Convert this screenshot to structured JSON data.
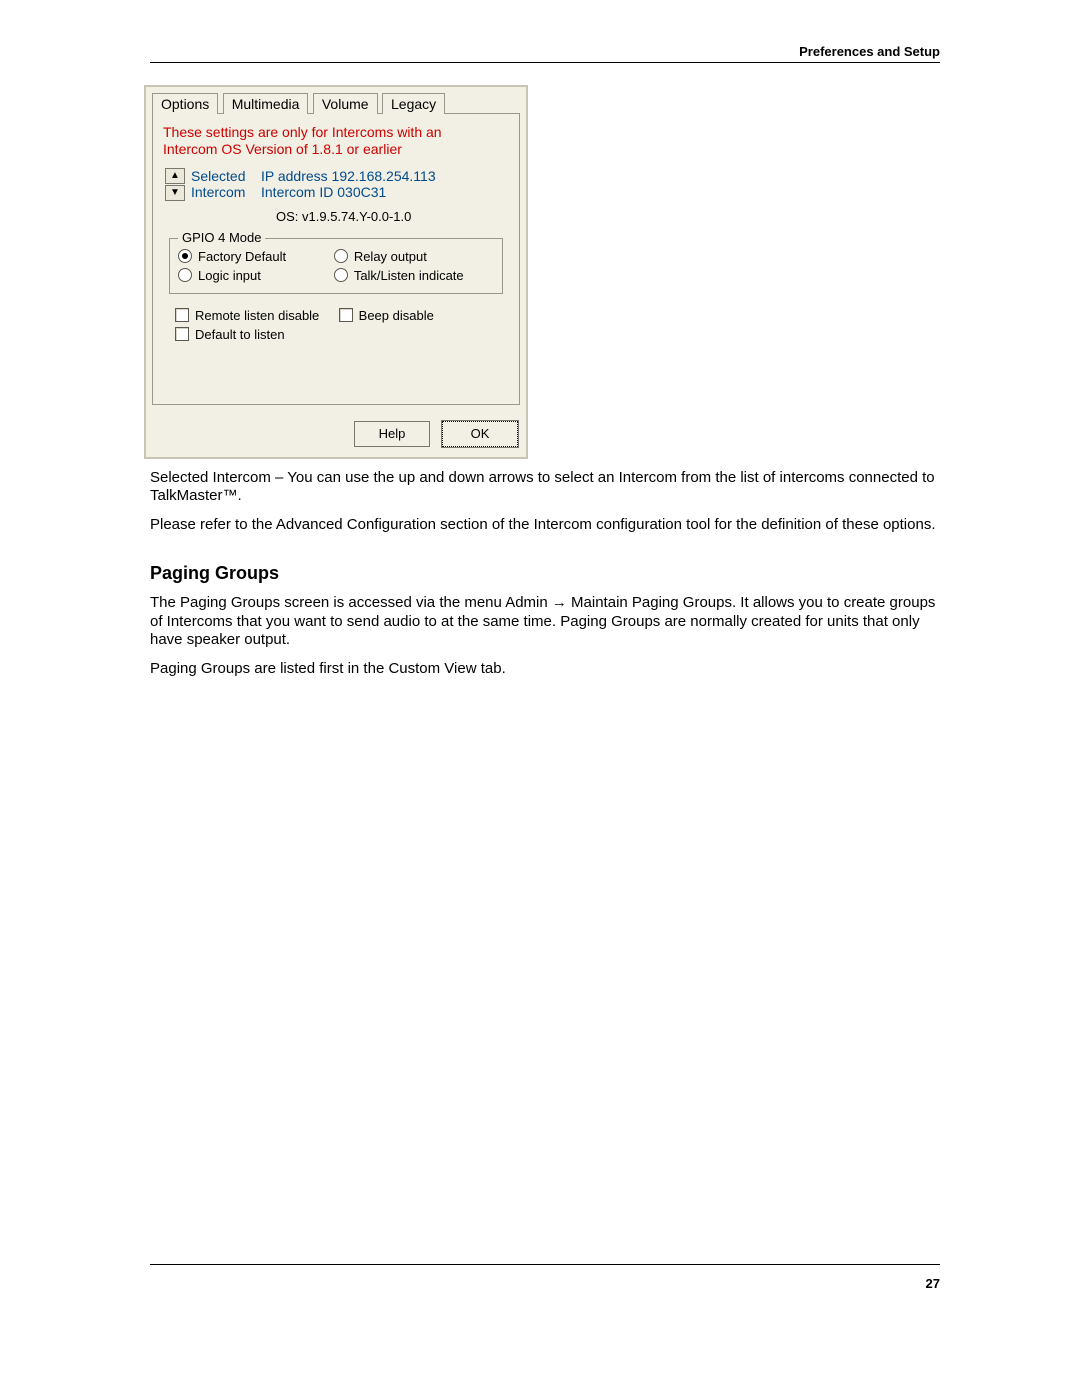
{
  "header": {
    "title": "Preferences and Setup"
  },
  "dialog": {
    "tabs": [
      "Options",
      "Multimedia",
      "Volume",
      "Legacy"
    ],
    "active_tab": "Legacy",
    "warning_line1": "These settings are only for Intercoms with an",
    "warning_line2": "Intercom OS Version of 1.8.1 or earlier",
    "selected": {
      "line1_label": "Selected",
      "line2_label": "Intercom",
      "ip_label": "IP address 192.168.254.113",
      "id_label": "Intercom ID 030C31"
    },
    "os_line": "OS:  v1.9.5.74.Y-0.0-1.0",
    "gpio": {
      "legend": "GPIO 4  Mode",
      "options": [
        {
          "label": "Factory Default",
          "selected": true
        },
        {
          "label": "Relay output",
          "selected": false
        },
        {
          "label": "Logic input",
          "selected": false
        },
        {
          "label": "Talk/Listen indicate",
          "selected": false
        }
      ]
    },
    "checks": [
      {
        "label": "Remote listen disable"
      },
      {
        "label": "Beep disable"
      },
      {
        "label": "Default to listen"
      }
    ],
    "help_btn": "Help",
    "ok_btn": "OK"
  },
  "body": {
    "p1": "Selected Intercom – You can use the up and down arrows to select an Intercom from the list of intercoms connected to TalkMaster™.",
    "p2": "Please refer to the Advanced Configuration section of the Intercom configuration tool for the definition of these options.",
    "heading": "Paging Groups",
    "p3": "The Paging Groups screen is accessed via the menu Admin → Maintain Paging Groups. It allows you to create groups of Intercoms that you want to send audio to at the same time. Paging Groups are normally created for units that only have speaker output.",
    "p4": "Paging Groups are listed first in the Custom View tab."
  },
  "page_number": "27"
}
